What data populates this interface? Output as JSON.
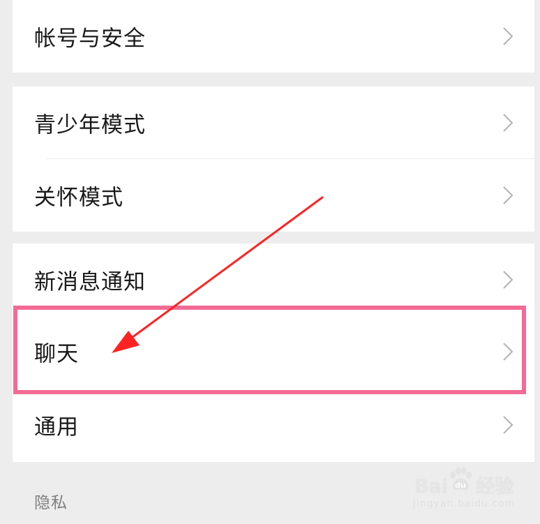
{
  "settings": {
    "items": [
      {
        "label": "帐号与安全"
      },
      {
        "label": "青少年模式"
      },
      {
        "label": "关怀模式"
      },
      {
        "label": "新消息通知"
      },
      {
        "label": "聊天"
      },
      {
        "label": "通用"
      }
    ],
    "section_header": "隐私"
  },
  "icons": {
    "chevron": "chevron-right-icon"
  },
  "annotation": {
    "highlight_color": "#f26b95",
    "arrow_color": "#ff2222",
    "highlighted_item": "聊天"
  },
  "watermark": {
    "brand_left": "Bai",
    "brand_right": "经验",
    "url": "jingyan.baidu.com"
  }
}
